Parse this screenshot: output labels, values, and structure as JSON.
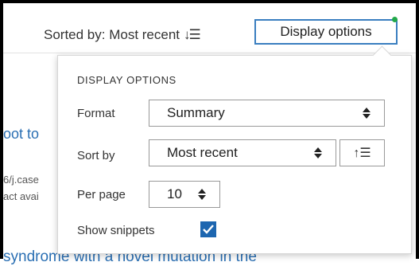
{
  "header": {
    "sorted_by_label": "Sorted by: Most recent",
    "sort_icon_glyph": "↓☰",
    "display_options_button": "Display options",
    "indicator_color": "#22a84a"
  },
  "background": {
    "link_fragment": "oot to",
    "text_fragment_1": "6/j.case",
    "text_fragment_2": "act avai",
    "bottom_fragment": "syndrome with a novel mutation in the"
  },
  "panel": {
    "title": "DISPLAY OPTIONS",
    "format": {
      "label": "Format",
      "value": "Summary"
    },
    "sort_by": {
      "label": "Sort by",
      "value": "Most recent",
      "order_icon": "↑☰"
    },
    "per_page": {
      "label": "Per page",
      "value": "10"
    },
    "show_snippets": {
      "label": "Show snippets",
      "checked": true,
      "check_glyph": "✔"
    }
  },
  "colors": {
    "accent": "#1d66b0",
    "link": "#2a6fb3",
    "button_border": "#3a7ec0"
  }
}
